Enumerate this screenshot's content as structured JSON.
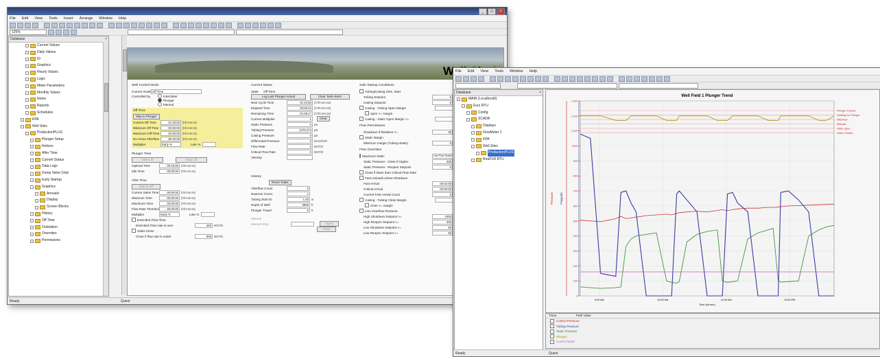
{
  "w1": {
    "menu": [
      "File",
      "Edit",
      "View",
      "Tools",
      "Insert",
      "Arrange",
      "Window",
      "Help"
    ],
    "zoom": "125%",
    "status_left": "Ready",
    "status_right": "Quest",
    "tree_header": "Database",
    "tree": [
      {
        "label": "Current Values",
        "indent": 3
      },
      {
        "label": "Daily Values",
        "indent": 3
      },
      {
        "label": "ID",
        "indent": 3
      },
      {
        "label": "Graphics",
        "indent": 3
      },
      {
        "label": "Hourly Values",
        "indent": 3
      },
      {
        "label": "Logic",
        "indent": 3
      },
      {
        "label": "Meter Parameters",
        "indent": 3
      },
      {
        "label": "Monthly Values",
        "indent": 3
      },
      {
        "label": "Notes",
        "indent": 3
      },
      {
        "label": "Reports",
        "indent": 3
      },
      {
        "label": "Schedules",
        "indent": 3
      },
      {
        "label": "KPA",
        "indent": 2
      },
      {
        "label": "Well Sitec",
        "indent": 2
      },
      {
        "label": "ProductionPLUS",
        "indent": 3
      },
      {
        "label": "Plunger Setup",
        "indent": 4
      },
      {
        "label": "Notices",
        "indent": 4
      },
      {
        "label": "After Time",
        "indent": 4
      },
      {
        "label": "Current Status",
        "indent": 4
      },
      {
        "label": "Data Logs",
        "indent": 4
      },
      {
        "label": "Dump Valve (Valv",
        "indent": 4
      },
      {
        "label": "Early Startup",
        "indent": 4
      },
      {
        "label": "Graphics",
        "indent": 4
      },
      {
        "label": "Annuals",
        "indent": 5
      },
      {
        "label": "Display",
        "indent": 5
      },
      {
        "label": "Screen Blocks",
        "indent": 5
      },
      {
        "label": "History",
        "indent": 4
      },
      {
        "label": "Off Time",
        "indent": 4
      },
      {
        "label": "Outstation",
        "indent": 4
      },
      {
        "label": "Overrides",
        "indent": 4
      },
      {
        "label": "Permissives",
        "indent": 4
      }
    ],
    "banner_title": "Well Site1",
    "control": {
      "title": "Well Control Mode",
      "current_mode_label": "Current mode",
      "current_mode_value": "Off Time",
      "controlled_by_label": "Controlled by",
      "options": [
        "Intermitter",
        "Plunger",
        "Manual"
      ],
      "off_time_title": "Off Time",
      "skip_button": "Skip to Plunger",
      "off_rows": [
        {
          "label": "Current Off Time",
          "value": "01:30:00",
          "unit": "(hh:mm:ss)"
        },
        {
          "label": "Minimum Off Time",
          "value": "00:30:00",
          "unit": "(hh:mm:ss)"
        },
        {
          "label": "Maximum Off Time",
          "value": "02:00:00",
          "unit": "(hh:mm:ss)"
        },
        {
          "label": "No Arrive Afterflow",
          "value": "00:30:00",
          "unit": "(hh:mm:ss)"
        }
      ],
      "multiplier_label": "Multiplier",
      "multiplier_value": "Early %",
      "late_label": "Late %",
      "plunger_title": "Plunger Time",
      "plunger_buttons": [
        "Start Lift",
        "Stop Lift"
      ],
      "plunger_rows": [
        {
          "label": "Optimal Time",
          "value": "00:15:00",
          "unit": "(hh:mm:ss)"
        },
        {
          "label": "Idle Time",
          "value": "00:05:00",
          "unit": "(hh:mm:ss)"
        }
      ],
      "after_title": "After Time",
      "after_button": "Skip to Off",
      "after_rows": [
        {
          "label": "Current Sales Time",
          "value": "00:00:00",
          "unit": "(hh:mm:ss)"
        },
        {
          "label": "Minimum Time",
          "value": "00:30:00",
          "unit": "(hh:mm:ss)"
        },
        {
          "label": "Maximum Time",
          "value": "00:00:00",
          "unit": "(hh:mm:ss)"
        },
        {
          "label": "Flow Rate Threshold",
          "value": "00:00:00",
          "unit": "(hh:mm:ss)"
        }
      ],
      "after_multiplier": "Early %",
      "extended_label": "Extended Flow Time",
      "extended_sub": "Extended Flow rate is over",
      "extended_value": "400",
      "extended_unit": "MCF/D",
      "sales_label": "Sales Close",
      "sales_sub": "Close if flow rate is under",
      "sales_value": "900",
      "sales_unit": "MCF/D"
    },
    "status": {
      "title": "Current Status",
      "state_label": "State",
      "state_value": "Off Time",
      "buttons": [
        "Log Last Plunger Arrival",
        "Clear Tank Alarm"
      ],
      "rows": [
        {
          "label": "Next Cycle Time",
          "value": "01:44:56",
          "unit": "(h:hh:mm:ss)"
        },
        {
          "label": "Elapsed Time",
          "value": "00:05:44",
          "unit": "(h:hh:mm:ss)"
        },
        {
          "label": "Remaining Time",
          "value": "01:09:17",
          "unit": "(h:hh:mm:ss)"
        },
        {
          "label": "Current Multiplier",
          "value": "1",
          "unit": ""
        },
        {
          "label": "Static Pressure",
          "value": "0",
          "unit": "psi"
        },
        {
          "label": "Tubing Pressure",
          "value": "1470.274",
          "unit": "psi"
        },
        {
          "label": "Casing Pressure",
          "value": "0",
          "unit": "psi"
        },
        {
          "label": "Differential Pressure",
          "value": "0",
          "unit": "inH2O/HR"
        },
        {
          "label": "Flow Rate",
          "value": "0",
          "unit": "MCF/D"
        },
        {
          "label": "Critical Flow Rate",
          "value": "0",
          "unit": "MCF/D"
        },
        {
          "label": "Velocity",
          "value": "",
          "unit": ""
        }
      ],
      "clear_button": "Clear",
      "history_title": "History",
      "reset_button": "Reset Totals",
      "history_rows": [
        {
          "label": "Afterflow Count",
          "value": "0",
          "unit": ""
        },
        {
          "label": "Noarrive Count",
          "value": "1",
          "unit": ""
        },
        {
          "label": "Tubing Start Di",
          "value": "1.00",
          "unit": "in"
        },
        {
          "label": "Depth of Well",
          "value": "9900",
          "unit": "ft"
        },
        {
          "label": "Plunger Travel",
          "value": "0",
          "unit": "ft"
        }
      ],
      "manual_label": "Manual",
      "manual_sub": "Manual Stop",
      "manual_buttons": [
        "Open",
        "Close"
      ]
    },
    "safe": {
      "title": "Safe Startup Conditions",
      "rows1": [
        {
          "label": "Tubing/Casing Sets. Start",
          "type": "chk"
        },
        {
          "label": "Tubing Setpoint",
          "value": "0"
        },
        {
          "label": "Casing Setpoint",
          "value": "0"
        },
        {
          "label": "Casing - Tubing Open Margin",
          "type": "chk",
          "value": "0"
        },
        {
          "label": "open >= margin",
          "type": "chk2"
        },
        {
          "label": "Casing - Static Open Margin >=",
          "type": "chk",
          "value": "0"
        }
      ],
      "perm_title": "Flow Permissives",
      "perm_rows": [
        {
          "label": "Shutdown If flowlines >=",
          "value": "30"
        },
        {
          "label": "Static Margin",
          "type": "chk"
        },
        {
          "label": "Minimum margin (Tubing-Static)",
          "value": "0"
        }
      ],
      "over_title": "Flow Overrides",
      "over_rows": [
        {
          "label": "Maximum Static",
          "type": "chk",
          "value": "Use Flow Static in Plunger"
        },
        {
          "label": "Static Pressure - Close if Higher",
          "value": "200"
        },
        {
          "label": "Static Pressure - Reopen Setpoint",
          "value": "0"
        },
        {
          "label": "Close if lower than Critical Flow Rate",
          "type": "chk"
        },
        {
          "label": "Fast Unloads w/rest Shutdown",
          "type": "chk"
        },
        {
          "label": "Fast Arrival",
          "value": "00:02:00"
        },
        {
          "label": "Critical Arrival",
          "value": "00:00:00"
        },
        {
          "label": "Current Fast Arrival Count",
          "value": "0"
        },
        {
          "label": "Casing - Tubing Close Margin",
          "type": "chk",
          "value": "0"
        },
        {
          "label": "close >= margin",
          "type": "chk2"
        },
        {
          "label": "Line Overflow Pressure",
          "type": "chk"
        },
        {
          "label": "High Shutdown Setpoint >=",
          "value": "1000"
        },
        {
          "label": "High Reopen Setpoint <=",
          "value": "300"
        },
        {
          "label": "Low Shutdown Setpoint <=",
          "value": "50"
        },
        {
          "label": "Low Reopen Setpoint >=",
          "value": "60"
        }
      ]
    }
  },
  "w2": {
    "menu": [
      "File",
      "Edit",
      "View",
      "Tools",
      "Window",
      "Help"
    ],
    "status_left": "Ready",
    "status_right": "Quest",
    "tree_header": "Database",
    "tree": [
      {
        "label": "MAIN (Localhost0)",
        "indent": 0,
        "icon": "db"
      },
      {
        "label": "Eurs RTU",
        "indent": 1
      },
      {
        "label": "Config",
        "indent": 2
      },
      {
        "label": "SCADA",
        "indent": 2
      },
      {
        "label": "Displays",
        "indent": 3
      },
      {
        "label": "FlowMeter 1",
        "indent": 3
      },
      {
        "label": "KPA",
        "indent": 3
      },
      {
        "label": "Well Sitec",
        "indent": 3
      },
      {
        "label": "ProductionPLUS",
        "indent": 4,
        "sel": true
      },
      {
        "label": "RealToD RTU",
        "indent": 3
      }
    ],
    "legend_header": [
      "Trace",
      "Path Value"
    ],
    "legend_items": [
      {
        "label": "Control Pressure",
        "color": "#cc2222"
      },
      {
        "label": "Tubing Pressure",
        "color": "#3a3aa0"
      },
      {
        "label": "Static Pressure",
        "color": "#2e8a2e"
      },
      {
        "label": "Plunger",
        "color": "#b58a00"
      },
      {
        "label": "Control Mode",
        "color": "#c060c0"
      }
    ]
  },
  "chart_data": {
    "type": "line",
    "title": "Well Field 1 Plunger Trend",
    "ylabel_left": "Pressure",
    "ylabel_right": "Psigrade",
    "y_ticks": [
      "1,300",
      "1,200",
      "1,100",
      "1000",
      "900",
      "800",
      "700",
      "600",
      "500",
      "400",
      "300",
      "200",
      "100",
      "0"
    ],
    "ylim": [
      0,
      1300
    ],
    "x_ticks": [
      "9:00 AM",
      "10:00 AM",
      "11:00 AM",
      "12:00 PM"
    ],
    "xlabel": "Time (hh:mm)",
    "right_labels": [
      "Plunger Closed",
      "Waiting for Plunger",
      "Afterflow",
      "Manual",
      "Valve open",
      "Valve Closed"
    ],
    "x": [
      0,
      0.04,
      0.08,
      0.14,
      0.16,
      0.18,
      0.2,
      0.22,
      0.26,
      0.3,
      0.34,
      0.36,
      0.38,
      0.39,
      0.42,
      0.46,
      0.5,
      0.54,
      0.56,
      0.58,
      0.6,
      0.62,
      0.66,
      0.7,
      0.74,
      0.76,
      0.78,
      0.79,
      0.82,
      0.86,
      0.9,
      0.94,
      0.97,
      1.0
    ],
    "series": [
      {
        "name": "Control Pressure",
        "color": "#cc3333",
        "values": [
          505,
          500,
          495,
          515,
          530,
          515,
          520,
          525,
          535,
          540,
          545,
          540,
          550,
          555,
          560,
          565,
          560,
          570,
          575,
          568,
          575,
          580,
          585,
          585,
          590,
          590,
          592,
          595,
          600,
          602,
          605,
          608,
          610,
          612
        ]
      },
      {
        "name": "Tubing Pressure",
        "color": "#3a3aa0",
        "values": [
          1080,
          1050,
          150,
          130,
          690,
          700,
          620,
          560,
          0,
          0,
          0,
          0,
          680,
          700,
          640,
          560,
          0,
          0,
          0,
          680,
          690,
          620,
          560,
          0,
          0,
          0,
          0,
          690,
          700,
          640,
          560,
          0,
          0,
          0
        ]
      },
      {
        "name": "Static Pressure",
        "color": "#2e8a2e",
        "values": [
          60,
          55,
          50,
          55,
          60,
          330,
          380,
          400,
          410,
          420,
          100,
          90,
          85,
          95,
          360,
          410,
          430,
          440,
          100,
          90,
          95,
          100,
          380,
          420,
          440,
          450,
          100,
          92,
          95,
          100,
          400,
          440,
          460,
          470
        ]
      },
      {
        "name": "Plunger",
        "color": "#b58a00",
        "values": [
          1200,
          1200,
          1200,
          1170,
          1170,
          1170,
          1200,
          1200,
          1200,
          1200,
          1170,
          1170,
          1170,
          1200,
          1200,
          1200,
          1200,
          1170,
          1170,
          1170,
          1200,
          1200,
          1200,
          1200,
          1170,
          1170,
          1170,
          1200,
          1200,
          1200,
          1200,
          1170,
          1170,
          1200
        ]
      },
      {
        "name": "Control Mode",
        "color": "#c060c0",
        "values": [
          160,
          160,
          160,
          160,
          160,
          160,
          160,
          160,
          160,
          160,
          160,
          160,
          160,
          160,
          160,
          160,
          160,
          160,
          160,
          160,
          160,
          160,
          160,
          160,
          160,
          160,
          160,
          160,
          160,
          160,
          160,
          160,
          160,
          160
        ]
      }
    ]
  }
}
